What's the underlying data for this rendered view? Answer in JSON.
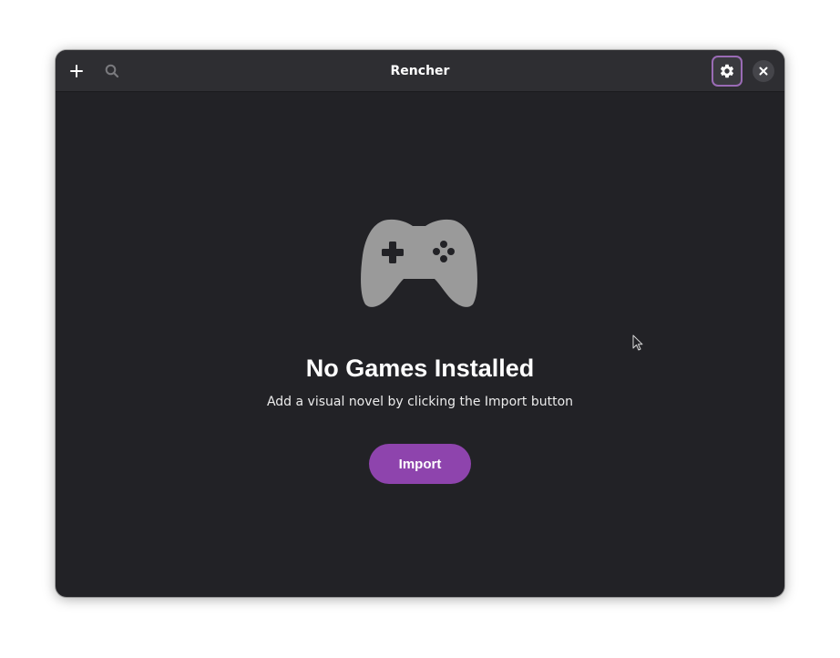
{
  "window": {
    "title": "Rencher"
  },
  "headerbar": {
    "add_icon": "plus-icon",
    "search_icon": "search-icon",
    "settings_icon": "gear-icon",
    "close_icon": "close-icon"
  },
  "status": {
    "icon": "gamepad-icon",
    "title": "No Games Installed",
    "description": "Add a visual novel by clicking the Import button",
    "import_label": "Import"
  },
  "colors": {
    "accent": "#8e44ad",
    "window_bg": "#222226",
    "headerbar_bg": "#2e2e32",
    "icon_gray": "#9a9a9a",
    "settings_focus_ring": "#9a6bb5"
  }
}
